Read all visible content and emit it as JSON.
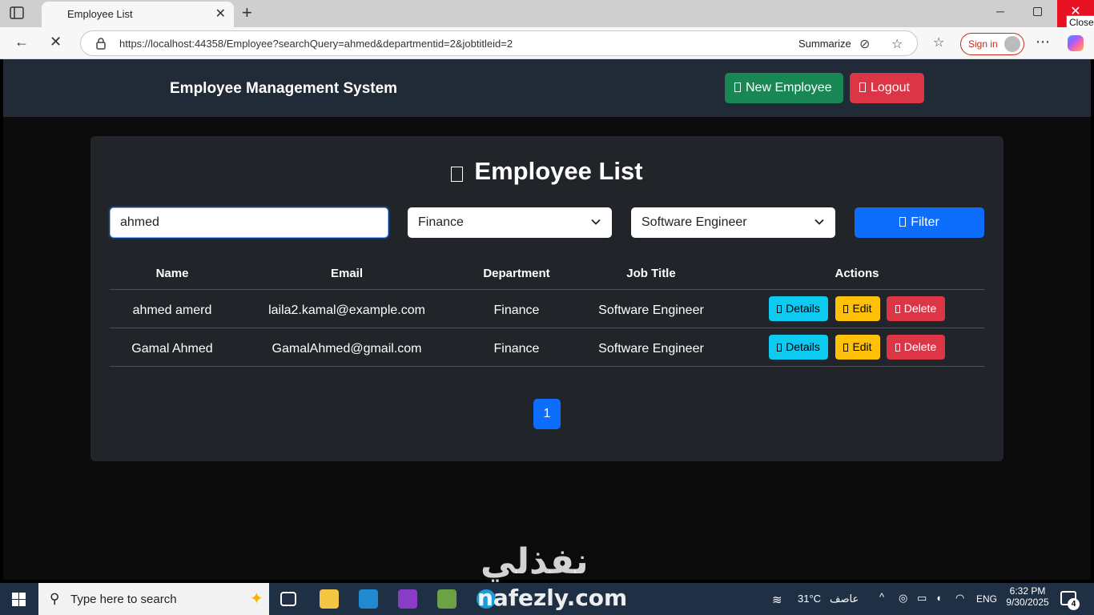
{
  "browser": {
    "tab_title": "Employee List",
    "url": "https://localhost:44358/Employee?searchQuery=ahmed&departmentid=2&jobtitleid=2",
    "summarize_label": "Summarize",
    "sign_in_label": "Sign in",
    "tooltip": "Close"
  },
  "header": {
    "brand": "Employee Management System",
    "new_employee_label": "New Employee",
    "logout_label": "Logout"
  },
  "page": {
    "title": "Employee List"
  },
  "filters": {
    "search_value": "ahmed",
    "department_selected": "Finance",
    "job_title_selected": "Software Engineer",
    "filter_button_label": "Filter"
  },
  "table": {
    "columns": [
      "Name",
      "Email",
      "Department",
      "Job Title",
      "Actions"
    ],
    "rows": [
      {
        "name": "ahmed amerd",
        "email": "laila2.kamal@example.com",
        "department": "Finance",
        "job_title": "Software Engineer"
      },
      {
        "name": "Gamal Ahmed",
        "email": "GamalAhmed@gmail.com",
        "department": "Finance",
        "job_title": "Software Engineer"
      }
    ],
    "actions": {
      "details": "Details",
      "edit": "Edit",
      "delete": "Delete"
    }
  },
  "pagination": {
    "current_page": "1"
  },
  "watermark": {
    "arabic": "نفذلي",
    "latin": "nafezly.com"
  },
  "taskbar": {
    "search_placeholder": "Type here to search",
    "temperature": "31°C",
    "weather_text": "عاصف",
    "language": "ENG",
    "time": "6:32 PM",
    "date": "9/30/2025",
    "notification_count": "4"
  },
  "colors": {
    "success": "#198754",
    "danger": "#dc3545",
    "primary": "#0d6efd",
    "info": "#0dcaf0",
    "warning": "#ffc107",
    "header_bg": "#212b38",
    "card_bg": "#212529"
  }
}
